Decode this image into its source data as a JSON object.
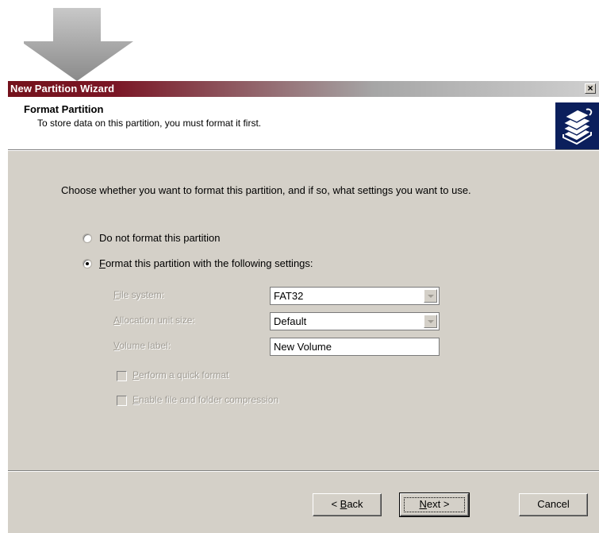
{
  "window": {
    "title": "New Partition Wizard",
    "close_label": "×"
  },
  "header": {
    "title": "Format Partition",
    "subtitle": "To store data on this partition, you must format it first.",
    "logo_icon": "disk-stack-icon"
  },
  "body": {
    "instruction": "Choose whether you want to format this partition, and if so, what settings you want to use."
  },
  "options": {
    "no_format": {
      "label": "Do not format this partition",
      "selected": false
    },
    "format": {
      "prefix": "F",
      "label": "ormat this partition with the following settings:",
      "selected": true
    }
  },
  "settings": {
    "file_system": {
      "accel": "F",
      "label": "ile system:",
      "value": "FAT32"
    },
    "allocation": {
      "accel": "A",
      "label": "llocation unit size:",
      "value": "Default"
    },
    "volume_label": {
      "accel": "V",
      "label": "olume label:",
      "value": "New Volume"
    }
  },
  "checkboxes": {
    "quick_format": {
      "accel": "P",
      "label": "erform a quick format",
      "checked": false,
      "enabled": false
    },
    "compression": {
      "accel": "E",
      "label": "nable file and folder compression",
      "checked": false,
      "enabled": false
    }
  },
  "buttons": {
    "back": {
      "prefix": "< ",
      "accel": "B",
      "rest": "ack"
    },
    "next": {
      "accel": "N",
      "rest": "ext >"
    },
    "cancel": "Cancel"
  },
  "colors": {
    "title_bar_start": "#74121c",
    "dialog_bg": "#d4d0c8",
    "logo_bg": "#0b1f5c",
    "disabled_text": "#a09c94"
  }
}
